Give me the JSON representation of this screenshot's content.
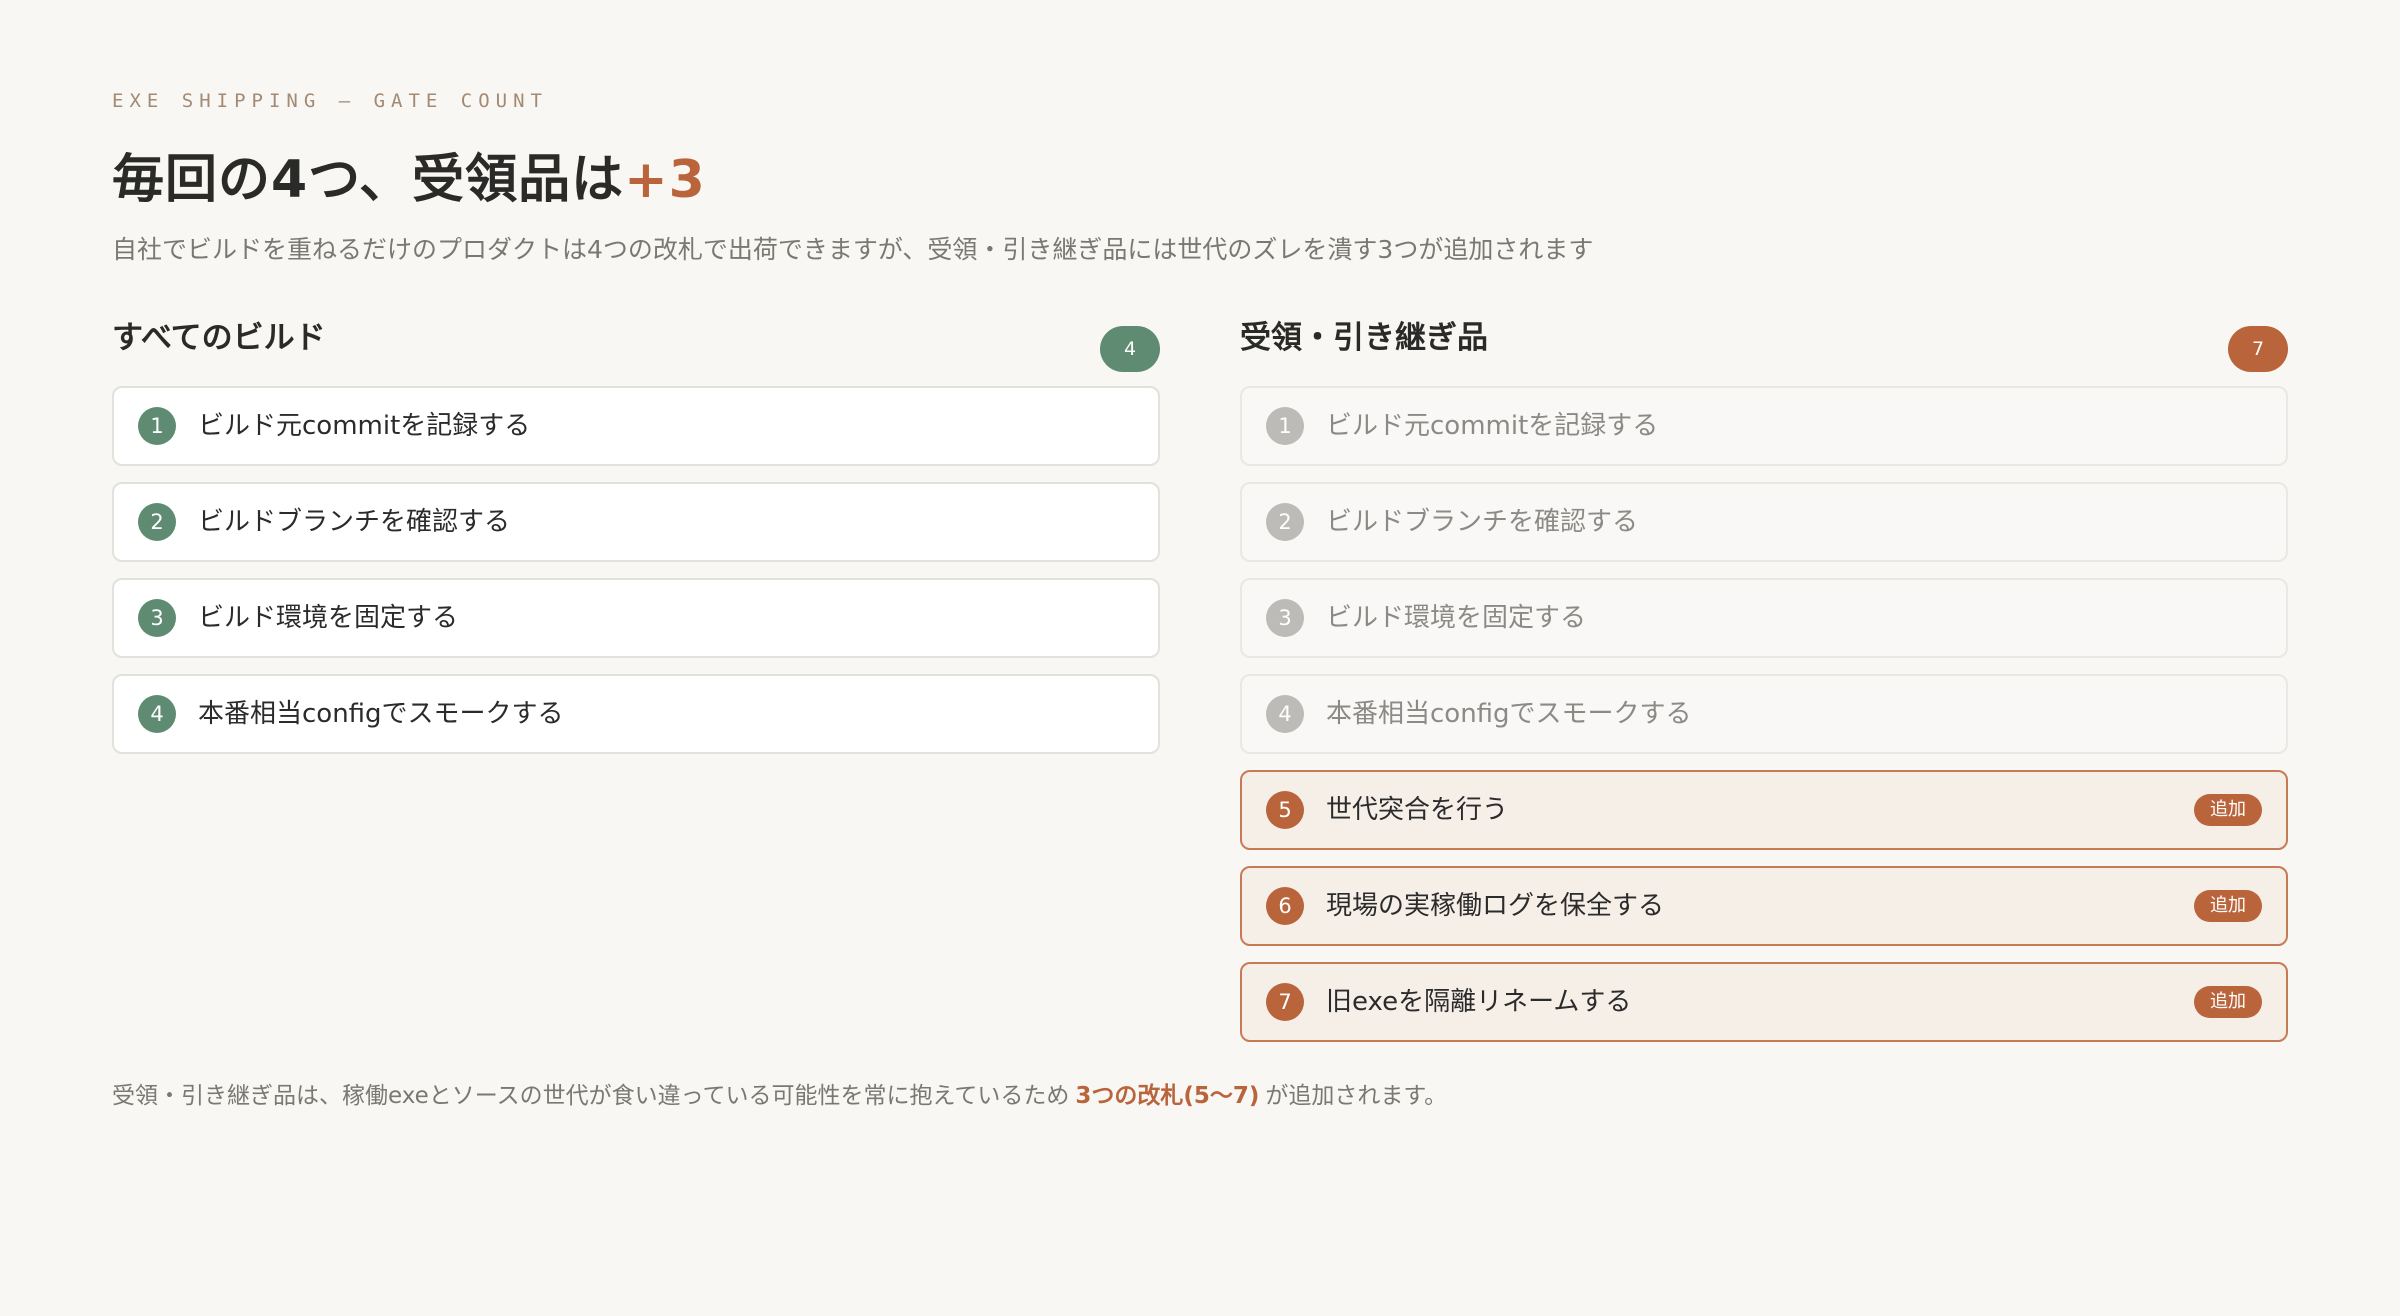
{
  "header": {
    "eyebrow": "EXE SHIPPING — GATE COUNT",
    "title_main": "毎回の4つ、受領品は",
    "title_accent": "+3",
    "subtitle": "自社でビルドを重ねるだけのプロダクトは4つの改札で出荷できますが、受領・引き継ぎ品には世代のズレを潰す3つが追加されます"
  },
  "left_column": {
    "title": "すべてのビルド",
    "count": "4",
    "items": [
      {
        "num": "1",
        "label": "ビルド元commitを記録する"
      },
      {
        "num": "2",
        "label": "ビルドブランチを確認する"
      },
      {
        "num": "3",
        "label": "ビルド環境を固定する"
      },
      {
        "num": "4",
        "label": "本番相当configでスモークする"
      }
    ]
  },
  "right_column": {
    "title": "受領・引き継ぎ品",
    "count": "7",
    "items": [
      {
        "num": "1",
        "label": "ビルド元commitを記録する"
      },
      {
        "num": "2",
        "label": "ビルドブランチを確認する"
      },
      {
        "num": "3",
        "label": "ビルド環境を固定する"
      },
      {
        "num": "4",
        "label": "本番相当configでスモークする"
      },
      {
        "num": "5",
        "label": "世代突合を行う",
        "tag": "追加"
      },
      {
        "num": "6",
        "label": "現場の実稼働ログを保全する",
        "tag": "追加"
      },
      {
        "num": "7",
        "label": "旧exeを隔離リネームする",
        "tag": "追加"
      }
    ]
  },
  "footer": {
    "note_prefix": "受領・引き継ぎ品は、稼働exeとソースの世代が食い違っている可能性を常に抱えているため",
    "note_emphasis": "3つの改札(5〜7)",
    "note_suffix": "が追加されます。"
  },
  "colors": {
    "accent": "#b9643a",
    "green": "#5e8b72",
    "muted": "#bdbbb7"
  }
}
